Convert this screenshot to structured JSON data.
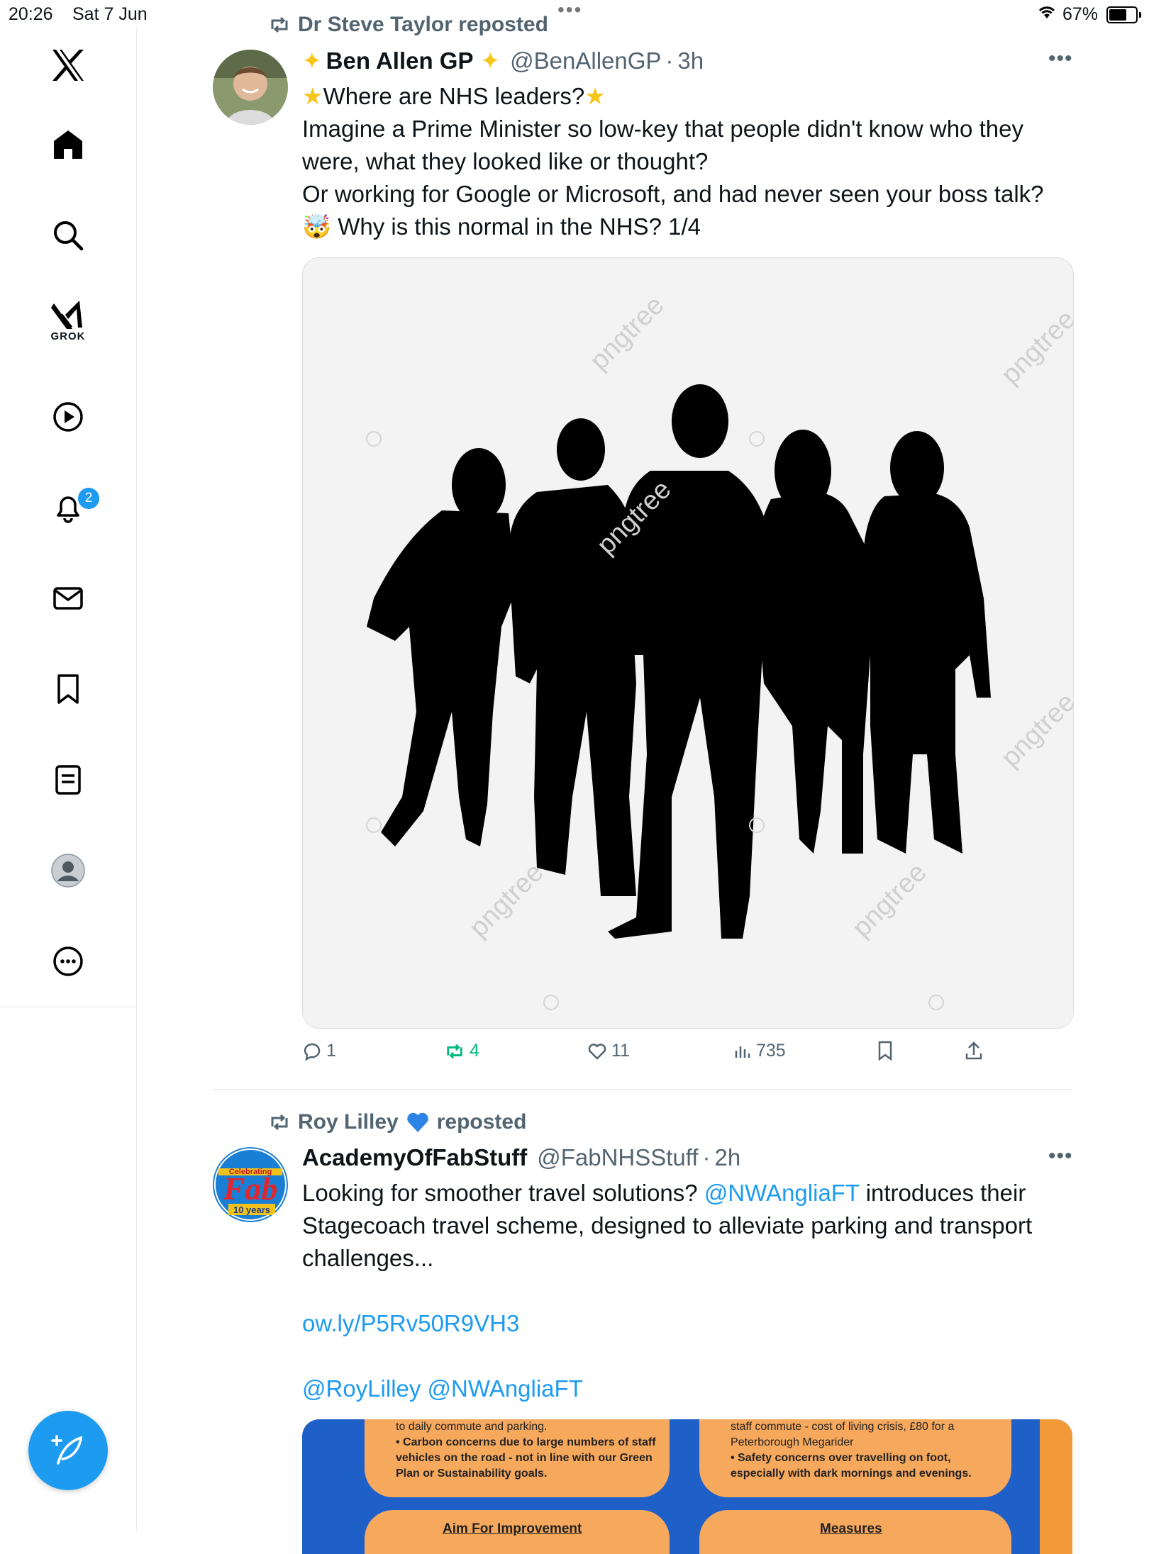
{
  "status_bar": {
    "time": "20:26",
    "date": "Sat 7 Jun",
    "battery": "67%",
    "battery_level": 0.67
  },
  "sidebar": {
    "items": [
      {
        "name": "x-logo"
      },
      {
        "name": "home"
      },
      {
        "name": "search"
      },
      {
        "name": "grok",
        "label": "GROK"
      },
      {
        "name": "video"
      },
      {
        "name": "notifications",
        "badge": "2"
      },
      {
        "name": "messages"
      },
      {
        "name": "bookmarks"
      },
      {
        "name": "lists"
      },
      {
        "name": "profile"
      },
      {
        "name": "more"
      }
    ]
  },
  "tweets": [
    {
      "reposted_by": "Dr Steve Taylor reposted",
      "author": {
        "name": "Ben Allen GP",
        "handle": "@BenAllenGP",
        "time": "3h"
      },
      "lines": [
        "Where are NHS leaders?",
        "Imagine a Prime Minister so low-key that people didn't know who they were, what they looked like or thought?",
        "Or working for Google or Microsoft, and had never seen your boss talk?",
        "Why is this normal in the NHS? 1/4"
      ],
      "media": {
        "watermark": "pngtree"
      },
      "stats": {
        "replies": "1",
        "reposts": "4",
        "likes": "11",
        "views": "735"
      }
    },
    {
      "reposted_by_name": "Roy Lilley",
      "reposted_suffix": "reposted",
      "author": {
        "name": "AcademyOfFabStuff",
        "handle": "@FabNHSStuff",
        "time": "2h"
      },
      "text_before_mention": "Looking for smoother travel solutions?",
      "mention": "@NWAngliaFT",
      "text_after_mention": "introduces their Stagecoach travel scheme, designed to alleviate parking and transport challenges...",
      "link": "ow.ly/P5Rv50R9VH3",
      "mentions_line": "@RoyLilley @NWAngliaFT",
      "avatar_text": {
        "top": "Celebrating",
        "mid": "Fab",
        "bottom": "10 years"
      },
      "media_text": {
        "left_line1": "to daily commute and parking.",
        "left_bullet1": "• Carbon concerns due to large numbers of staff",
        "left_bullet1b": "vehicles on the road - not in line with our Green",
        "left_bullet1c": "Plan or Sustainability goals.",
        "right_line1": "staff commute - cost of living crisis, £80 for a",
        "right_line2": "Peterborough Megarider",
        "right_bullet1": "• Safety concerns over travelling on foot,",
        "right_bullet1b": "especially with dark mornings and evenings.",
        "heading_left": "Aim For Improvement",
        "heading_right": "Measures"
      }
    }
  ],
  "colors": {
    "accent": "#1d9bf0",
    "repost_green": "#00ba7c",
    "muted": "#536471"
  }
}
